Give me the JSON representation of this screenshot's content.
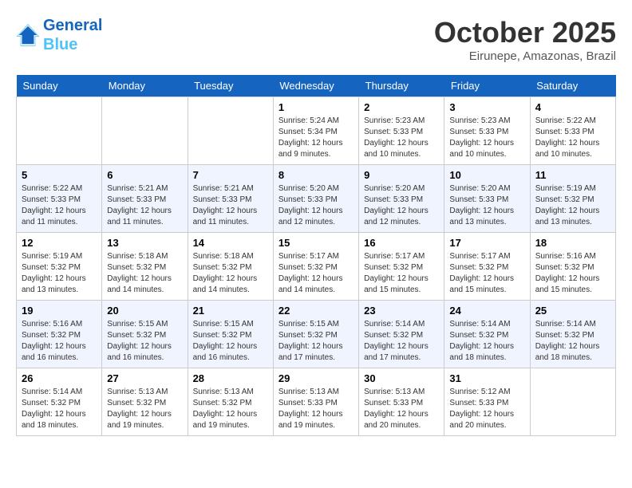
{
  "header": {
    "logo_line1": "General",
    "logo_line2": "Blue",
    "month": "October 2025",
    "location": "Eirunepe, Amazonas, Brazil"
  },
  "days_of_week": [
    "Sunday",
    "Monday",
    "Tuesday",
    "Wednesday",
    "Thursday",
    "Friday",
    "Saturday"
  ],
  "weeks": [
    [
      {
        "day": "",
        "info": ""
      },
      {
        "day": "",
        "info": ""
      },
      {
        "day": "",
        "info": ""
      },
      {
        "day": "1",
        "info": "Sunrise: 5:24 AM\nSunset: 5:34 PM\nDaylight: 12 hours\nand 9 minutes."
      },
      {
        "day": "2",
        "info": "Sunrise: 5:23 AM\nSunset: 5:33 PM\nDaylight: 12 hours\nand 10 minutes."
      },
      {
        "day": "3",
        "info": "Sunrise: 5:23 AM\nSunset: 5:33 PM\nDaylight: 12 hours\nand 10 minutes."
      },
      {
        "day": "4",
        "info": "Sunrise: 5:22 AM\nSunset: 5:33 PM\nDaylight: 12 hours\nand 10 minutes."
      }
    ],
    [
      {
        "day": "5",
        "info": "Sunrise: 5:22 AM\nSunset: 5:33 PM\nDaylight: 12 hours\nand 11 minutes."
      },
      {
        "day": "6",
        "info": "Sunrise: 5:21 AM\nSunset: 5:33 PM\nDaylight: 12 hours\nand 11 minutes."
      },
      {
        "day": "7",
        "info": "Sunrise: 5:21 AM\nSunset: 5:33 PM\nDaylight: 12 hours\nand 11 minutes."
      },
      {
        "day": "8",
        "info": "Sunrise: 5:20 AM\nSunset: 5:33 PM\nDaylight: 12 hours\nand 12 minutes."
      },
      {
        "day": "9",
        "info": "Sunrise: 5:20 AM\nSunset: 5:33 PM\nDaylight: 12 hours\nand 12 minutes."
      },
      {
        "day": "10",
        "info": "Sunrise: 5:20 AM\nSunset: 5:33 PM\nDaylight: 12 hours\nand 13 minutes."
      },
      {
        "day": "11",
        "info": "Sunrise: 5:19 AM\nSunset: 5:32 PM\nDaylight: 12 hours\nand 13 minutes."
      }
    ],
    [
      {
        "day": "12",
        "info": "Sunrise: 5:19 AM\nSunset: 5:32 PM\nDaylight: 12 hours\nand 13 minutes."
      },
      {
        "day": "13",
        "info": "Sunrise: 5:18 AM\nSunset: 5:32 PM\nDaylight: 12 hours\nand 14 minutes."
      },
      {
        "day": "14",
        "info": "Sunrise: 5:18 AM\nSunset: 5:32 PM\nDaylight: 12 hours\nand 14 minutes."
      },
      {
        "day": "15",
        "info": "Sunrise: 5:17 AM\nSunset: 5:32 PM\nDaylight: 12 hours\nand 14 minutes."
      },
      {
        "day": "16",
        "info": "Sunrise: 5:17 AM\nSunset: 5:32 PM\nDaylight: 12 hours\nand 15 minutes."
      },
      {
        "day": "17",
        "info": "Sunrise: 5:17 AM\nSunset: 5:32 PM\nDaylight: 12 hours\nand 15 minutes."
      },
      {
        "day": "18",
        "info": "Sunrise: 5:16 AM\nSunset: 5:32 PM\nDaylight: 12 hours\nand 15 minutes."
      }
    ],
    [
      {
        "day": "19",
        "info": "Sunrise: 5:16 AM\nSunset: 5:32 PM\nDaylight: 12 hours\nand 16 minutes."
      },
      {
        "day": "20",
        "info": "Sunrise: 5:15 AM\nSunset: 5:32 PM\nDaylight: 12 hours\nand 16 minutes."
      },
      {
        "day": "21",
        "info": "Sunrise: 5:15 AM\nSunset: 5:32 PM\nDaylight: 12 hours\nand 16 minutes."
      },
      {
        "day": "22",
        "info": "Sunrise: 5:15 AM\nSunset: 5:32 PM\nDaylight: 12 hours\nand 17 minutes."
      },
      {
        "day": "23",
        "info": "Sunrise: 5:14 AM\nSunset: 5:32 PM\nDaylight: 12 hours\nand 17 minutes."
      },
      {
        "day": "24",
        "info": "Sunrise: 5:14 AM\nSunset: 5:32 PM\nDaylight: 12 hours\nand 18 minutes."
      },
      {
        "day": "25",
        "info": "Sunrise: 5:14 AM\nSunset: 5:32 PM\nDaylight: 12 hours\nand 18 minutes."
      }
    ],
    [
      {
        "day": "26",
        "info": "Sunrise: 5:14 AM\nSunset: 5:32 PM\nDaylight: 12 hours\nand 18 minutes."
      },
      {
        "day": "27",
        "info": "Sunrise: 5:13 AM\nSunset: 5:32 PM\nDaylight: 12 hours\nand 19 minutes."
      },
      {
        "day": "28",
        "info": "Sunrise: 5:13 AM\nSunset: 5:32 PM\nDaylight: 12 hours\nand 19 minutes."
      },
      {
        "day": "29",
        "info": "Sunrise: 5:13 AM\nSunset: 5:33 PM\nDaylight: 12 hours\nand 19 minutes."
      },
      {
        "day": "30",
        "info": "Sunrise: 5:13 AM\nSunset: 5:33 PM\nDaylight: 12 hours\nand 20 minutes."
      },
      {
        "day": "31",
        "info": "Sunrise: 5:12 AM\nSunset: 5:33 PM\nDaylight: 12 hours\nand 20 minutes."
      },
      {
        "day": "",
        "info": ""
      }
    ]
  ]
}
